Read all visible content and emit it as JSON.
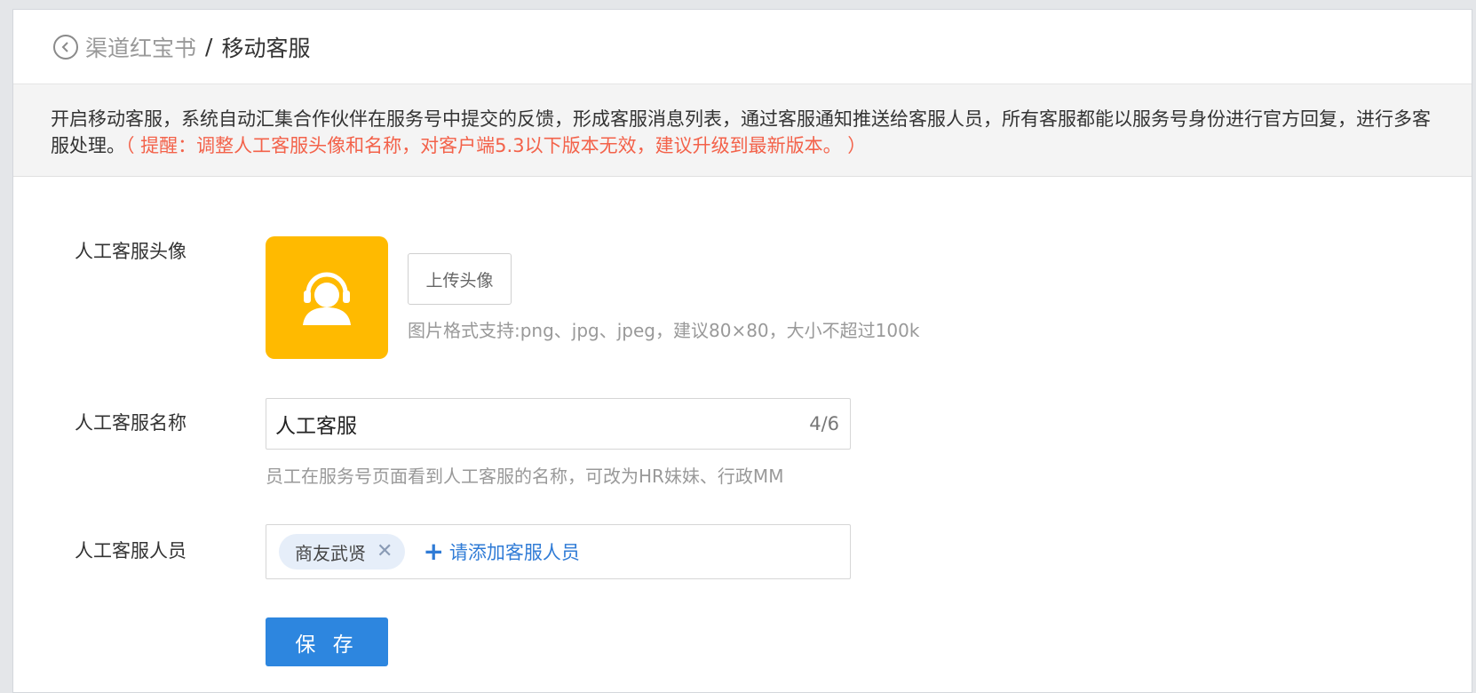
{
  "header": {
    "back_label": "渠道红宝书",
    "separator": "/",
    "current_page": "移动客服"
  },
  "notice": {
    "text": "开启移动客服，系统自动汇集合作伙伴在服务号中提交的反馈，形成客服消息列表，通过客服通知推送给客服人员，所有客服都能以服务号身份进行官方回复，进行多客服处理。",
    "warning": "（ 提醒：调整人工客服头像和名称，对客户端5.3以下版本无效，建议升级到最新版本。 ）"
  },
  "form": {
    "avatar": {
      "label": "人工客服头像",
      "upload_button": "上传头像",
      "hint": "图片格式支持:png、jpg、jpeg，建议80×80，大小不超过100k"
    },
    "name": {
      "label": "人工客服名称",
      "value": "人工客服",
      "counter": "4/6",
      "hint": "员工在服务号页面看到人工客服的名称，可改为HR妹妹、行政MM"
    },
    "staff": {
      "label": "人工客服人员",
      "tags": [
        {
          "name": "商友武贤"
        }
      ],
      "add_label": "请添加客服人员"
    },
    "save_button": "保 存"
  },
  "colors": {
    "accent": "#2d86df",
    "warning": "#f3624a",
    "avatar_bg": "#ffba00"
  }
}
